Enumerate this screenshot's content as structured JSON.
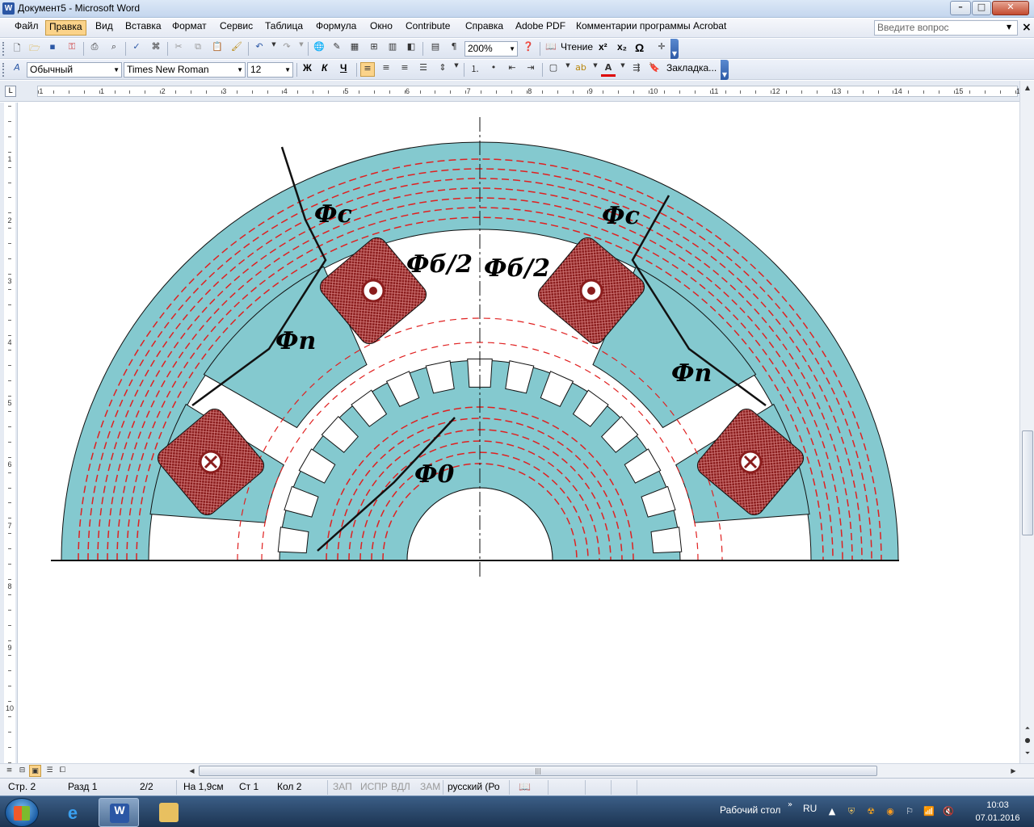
{
  "window": {
    "title": "Документ5 - Microsoft Word",
    "app_icon": "W",
    "minimize_glyph": "–",
    "maximize_glyph": "□",
    "close_glyph": "✕"
  },
  "menu": {
    "items": [
      "Файл",
      "Правка",
      "Вид",
      "Вставка",
      "Формат",
      "Сервис",
      "Таблица",
      "Формула",
      "Окно",
      "Contribute",
      "Справка",
      "Adobe PDF",
      "Комментарии программы Acrobat"
    ],
    "active": "Правка",
    "ask_placeholder": "Введите вопрос",
    "close_doc_glyph": "×"
  },
  "toolbar_standard": {
    "zoom": "200%",
    "reading_label": "Чтение",
    "superscript_label": "x²",
    "subscript_label": "x₂",
    "omega_label": "Ω",
    "pilcrow_label": "¶"
  },
  "toolbar_format": {
    "style": "Обычный",
    "font": "Times New Roman",
    "size": "12",
    "bold_label": "Ж",
    "italic_label": "К",
    "underline_label": "Ч",
    "bookmark_label": "Закладка..."
  },
  "ruler": {
    "h_numbers": [
      "1",
      "1",
      "2",
      "3",
      "4",
      "5",
      "6",
      "7",
      "8",
      "9",
      "10",
      "11",
      "12",
      "13",
      "14",
      "15",
      "16"
    ],
    "v_numbers": [
      "1",
      "2",
      "3",
      "4",
      "5",
      "6",
      "7",
      "8",
      "9",
      "10"
    ],
    "corner_glyph": "L"
  },
  "figure": {
    "labels": {
      "phi_c_left": "Фc",
      "phi_c_right": "Фc",
      "phi_delta_left": "Фб/2",
      "phi_delta_right": "Фб/2",
      "phi_n_left": "Фп",
      "phi_n_right": "Фп",
      "phi_0": "Ф0"
    },
    "colors": {
      "core": "#84c9cf",
      "flux": "#e02020",
      "coil": "#8a1d1d",
      "outline": "#111111"
    }
  },
  "status": {
    "page": "Стр. 2",
    "section": "Разд 1",
    "pages": "2/2",
    "at": "На 1,9см",
    "line": "Ст 1",
    "col": "Кол 2",
    "rec": "ЗАП",
    "trk": "ИСПР",
    "ext": "ВДЛ",
    "ovr": "ЗАМ",
    "language": "русский (Ро"
  },
  "taskbar": {
    "desktop_label": "Рабочий стол",
    "lang": "RU",
    "time": "10:03",
    "date": "07.01.2016",
    "word_icon": "W",
    "ie_icon": "e"
  }
}
